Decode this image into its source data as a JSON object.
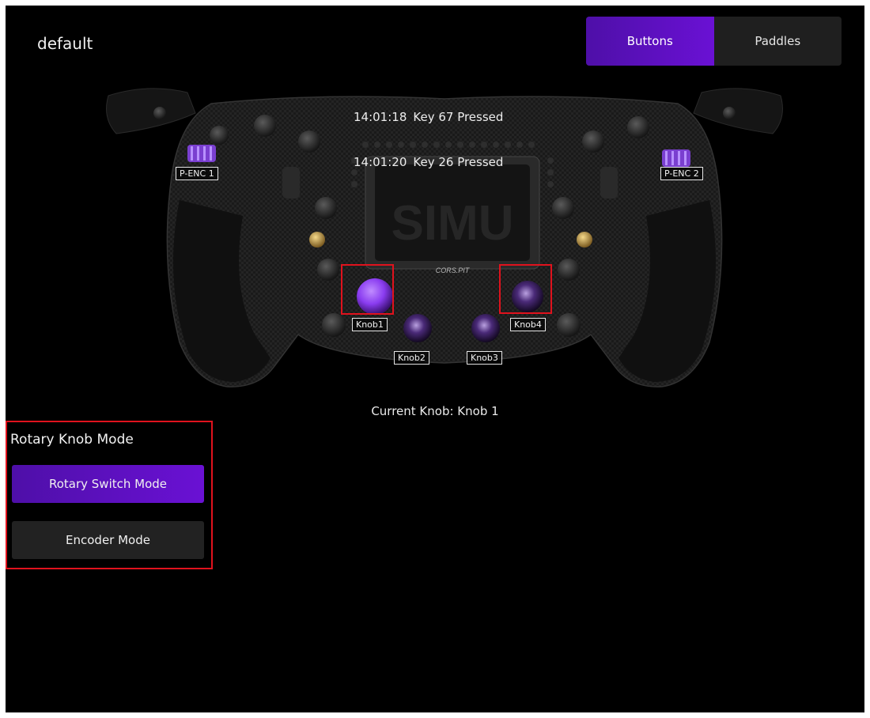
{
  "profile": {
    "name": "default"
  },
  "tabs": [
    {
      "label": "Buttons",
      "active": true
    },
    {
      "label": "Paddles",
      "active": false
    }
  ],
  "log": [
    {
      "time": "14:01:18",
      "text": "Key 67 Pressed"
    },
    {
      "time": "14:01:20",
      "text": "Key 26 Pressed"
    }
  ],
  "wheel": {
    "brand": "CORS.PIT",
    "watermark": "SIMU",
    "labels": {
      "penc1": "P-ENC 1",
      "penc2": "P-ENC 2",
      "knob1": "Knob1",
      "knob2": "Knob2",
      "knob3": "Knob3",
      "knob4": "Knob4"
    }
  },
  "current_knob": "Current Knob: Knob 1",
  "mode_panel": {
    "title": "Rotary Knob Mode",
    "buttons": [
      {
        "label": "Rotary Switch Mode",
        "active": true
      },
      {
        "label": "Encoder Mode",
        "active": false
      }
    ]
  },
  "colors": {
    "accent": "#5f10c8",
    "highlight": "#e0121d",
    "knob_purple": "#8a3cf0"
  }
}
